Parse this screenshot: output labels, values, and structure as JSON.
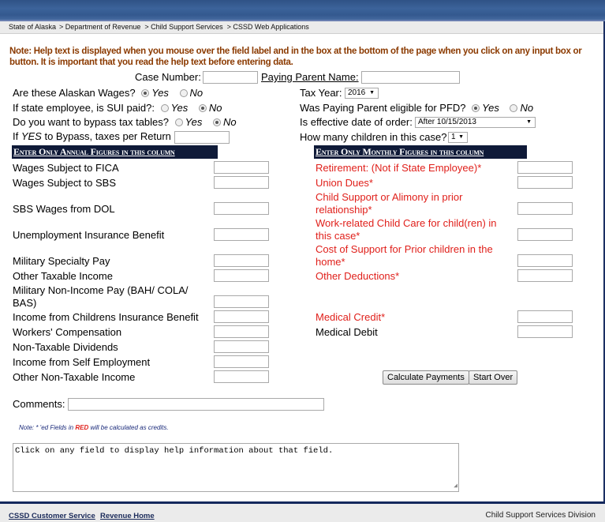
{
  "breadcrumb": [
    "State of Alaska",
    "> Department of Revenue",
    "> Child Support Services",
    "> CSSD Web Applications"
  ],
  "note": "Note: Help text is displayed when you mouse over the field label and in the box at the bottom of the page when you click on any input box or button. It is important that you read the help text before entering data.",
  "case": {
    "case_number_label": "Case Number:",
    "case_number_value": "",
    "paying_parent_label": "Paying Parent Name:",
    "paying_parent_value": ""
  },
  "questions_left": [
    {
      "label": "Are these Alaskan Wages?",
      "options": [
        "Yes",
        "No"
      ],
      "selected": "Yes"
    },
    {
      "label": "If state employee, is SUI paid?:",
      "options": [
        "Yes",
        "No"
      ],
      "selected": "No"
    },
    {
      "label": "Do you want to bypass tax tables?",
      "options": [
        "Yes",
        "No"
      ],
      "selected": "No"
    }
  ],
  "bypass": {
    "prefix": "If ",
    "emph": "YES",
    "suffix": " to Bypass, taxes per Return",
    "value": ""
  },
  "questions_right": {
    "tax_year_label": "Tax Year:",
    "tax_year_value": "2016",
    "pfd_label": "Was Paying Parent eligible for PFD?",
    "pfd_options": [
      "Yes",
      "No"
    ],
    "pfd_selected": "Yes",
    "effective_date_label": "Is effective date of order:",
    "effective_date_value": "After 10/15/2013",
    "children_label": "How many children in this case?",
    "children_value": "1"
  },
  "annual_column": {
    "heading": "Enter Only Annual Figures in this column",
    "fields": [
      {
        "label": "Wages Subject to FICA",
        "value": ""
      },
      {
        "label": "Wages Subject to SBS",
        "value": ""
      },
      {
        "label": "SBS Wages from DOL",
        "value": ""
      },
      {
        "label": "Unemployment Insurance Benefit",
        "value": ""
      },
      {
        "label": "Military Specialty Pay",
        "value": ""
      },
      {
        "label": "Other Taxable Income",
        "value": ""
      },
      {
        "label": "Military Non-Income Pay (BAH/ COLA/ BAS)",
        "value": ""
      },
      {
        "label": "Income from Childrens Insurance Benefit",
        "value": ""
      },
      {
        "label": "Workers' Compensation",
        "value": ""
      },
      {
        "label": "Non-Taxable Dividends",
        "value": ""
      },
      {
        "label": "Income from Self Employment",
        "value": ""
      },
      {
        "label": "Other Non-Taxable Income",
        "value": ""
      }
    ]
  },
  "monthly_column": {
    "heading": "Enter Only Monthly Figures in this column",
    "fields": [
      {
        "label": "Retirement: (Not if State Employee)*",
        "credit": true,
        "value": ""
      },
      {
        "label": "Union Dues*",
        "credit": true,
        "value": ""
      },
      {
        "label": "Child Support or Alimony in prior relationship*",
        "credit": true,
        "value": ""
      },
      {
        "label": "Work-related Child Care for child(ren) in this case*",
        "credit": true,
        "value": ""
      },
      {
        "label": "Cost of Support for Prior children in the home*",
        "credit": true,
        "value": ""
      },
      {
        "label": "Other Deductions*",
        "credit": true,
        "value": ""
      },
      {
        "label": "Medical Credit*",
        "credit": true,
        "value": ""
      },
      {
        "label": "Medical Debit",
        "credit": false,
        "value": ""
      }
    ]
  },
  "buttons": {
    "calculate": "Calculate Payments",
    "start_over": "Start Over"
  },
  "comments": {
    "label": "Comments:",
    "value": ""
  },
  "credits_note": {
    "prefix": "Note: * 'ed Fields in ",
    "red": "RED",
    "suffix": " will be calculated as credits."
  },
  "help_box": "Click on any field to display help information about that field.",
  "footer": {
    "links": [
      "CSSD Customer Service",
      "Revenue Home"
    ],
    "division": "Child Support Services Division"
  },
  "colors": {
    "note": "#8b3a00",
    "credit_red": "#e0201b",
    "navy": "#0f1a38"
  }
}
